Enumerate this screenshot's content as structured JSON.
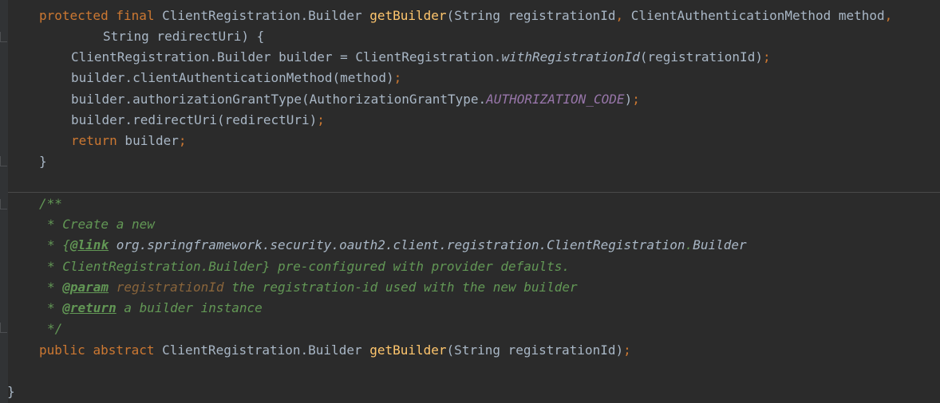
{
  "editor": {
    "language": "java",
    "lines": [
      {
        "indent": 4,
        "tokens": [
          {
            "t": "protected",
            "c": "kw"
          },
          {
            "t": " ",
            "c": "id"
          },
          {
            "t": "final",
            "c": "kw"
          },
          {
            "t": " ClientRegistration.Builder ",
            "c": "id"
          },
          {
            "t": "getBuilder",
            "c": "fn"
          },
          {
            "t": "(String registrationId",
            "c": "id"
          },
          {
            "t": ",",
            "c": "pu"
          },
          {
            "t": " ClientAuthenticationMethod method",
            "c": "id"
          },
          {
            "t": ",",
            "c": "pu"
          }
        ]
      },
      {
        "indent": 12,
        "tokens": [
          {
            "t": "String redirectUri) {",
            "c": "id"
          }
        ]
      },
      {
        "indent": 8,
        "tokens": [
          {
            "t": "ClientRegistration.Builder builder = ClientRegistration.",
            "c": "id"
          },
          {
            "t": "withRegistrationId",
            "c": "st"
          },
          {
            "t": "(registrationId)",
            "c": "id"
          },
          {
            "t": ";",
            "c": "pu"
          }
        ]
      },
      {
        "indent": 8,
        "tokens": [
          {
            "t": "builder.clientAuthenticationMethod(method)",
            "c": "id"
          },
          {
            "t": ";",
            "c": "pu"
          }
        ]
      },
      {
        "indent": 8,
        "tokens": [
          {
            "t": "builder.authorizationGrantType(AuthorizationGrantType.",
            "c": "id"
          },
          {
            "t": "AUTHORIZATION_CODE",
            "c": "cn"
          },
          {
            "t": ")",
            "c": "id"
          },
          {
            "t": ";",
            "c": "pu"
          }
        ]
      },
      {
        "indent": 8,
        "tokens": [
          {
            "t": "builder.redirectUri(redirectUri)",
            "c": "id"
          },
          {
            "t": ";",
            "c": "pu"
          }
        ]
      },
      {
        "indent": 8,
        "tokens": [
          {
            "t": "return",
            "c": "kw"
          },
          {
            "t": " builder",
            "c": "id"
          },
          {
            "t": ";",
            "c": "pu"
          }
        ]
      },
      {
        "indent": 4,
        "tokens": [
          {
            "t": "}",
            "c": "id"
          }
        ]
      },
      {
        "indent": 0,
        "separator": true,
        "tokens": []
      },
      {
        "indent": 4,
        "tokens": [
          {
            "t": "/**",
            "c": "dc"
          }
        ]
      },
      {
        "indent": 5,
        "tokens": [
          {
            "t": "* Create a new",
            "c": "dc"
          }
        ]
      },
      {
        "indent": 5,
        "tokens": [
          {
            "t": "* {",
            "c": "dc"
          },
          {
            "t": "@link",
            "c": "tag"
          },
          {
            "t": " org.springframework.security.oauth2.client.registration.ClientRegistration",
            "c": "lnk"
          },
          {
            "t": ".",
            "c": "dc"
          },
          {
            "t": "Builder",
            "c": "lnk"
          }
        ]
      },
      {
        "indent": 5,
        "tokens": [
          {
            "t": "* ClientRegistration.Builder} pre-configured with provider defaults.",
            "c": "dc"
          }
        ]
      },
      {
        "indent": 5,
        "tokens": [
          {
            "t": "* ",
            "c": "dc"
          },
          {
            "t": "@param",
            "c": "tag"
          },
          {
            "t": " ",
            "c": "dc"
          },
          {
            "t": "registrationId",
            "c": "dpar"
          },
          {
            "t": " the registration-id used with the new builder",
            "c": "dc"
          }
        ]
      },
      {
        "indent": 5,
        "tokens": [
          {
            "t": "* ",
            "c": "dc"
          },
          {
            "t": "@return",
            "c": "tag"
          },
          {
            "t": " a builder instance",
            "c": "dc"
          }
        ]
      },
      {
        "indent": 5,
        "tokens": [
          {
            "t": "*/",
            "c": "dc"
          }
        ]
      },
      {
        "indent": 4,
        "tokens": [
          {
            "t": "public",
            "c": "kw"
          },
          {
            "t": " ",
            "c": "id"
          },
          {
            "t": "abstract",
            "c": "kw"
          },
          {
            "t": " ClientRegistration.Builder ",
            "c": "id"
          },
          {
            "t": "getBuilder",
            "c": "fn"
          },
          {
            "t": "(String registrationId)",
            "c": "id"
          },
          {
            "t": ";",
            "c": "pu"
          }
        ]
      },
      {
        "indent": 0,
        "tokens": []
      },
      {
        "indent": 0,
        "tokens": [
          {
            "t": "}",
            "c": "id"
          }
        ]
      }
    ]
  }
}
